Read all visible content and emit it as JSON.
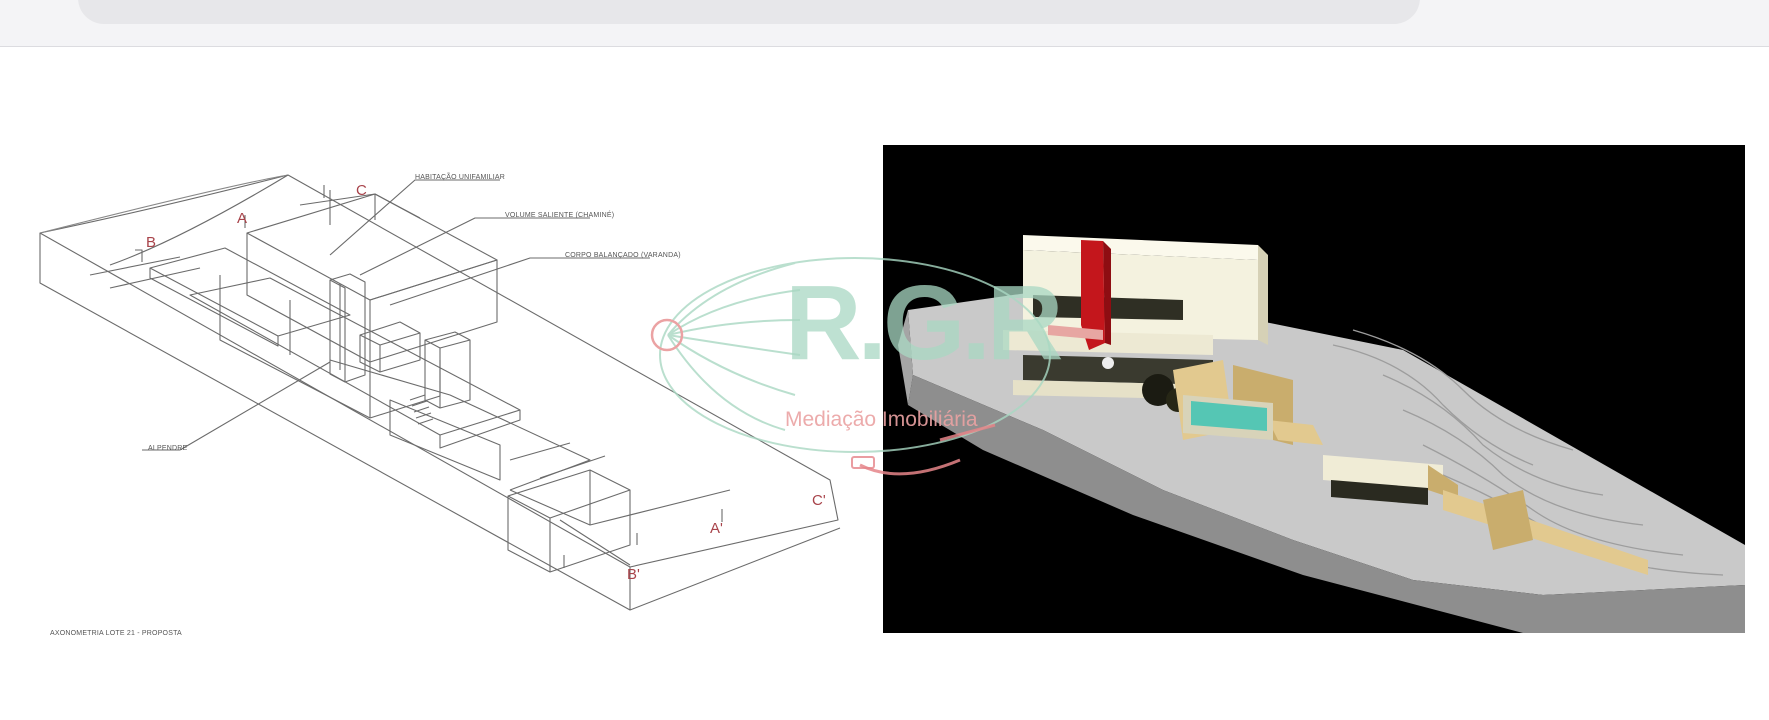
{
  "drawing": {
    "labels": {
      "l1": "HABITAÇÃO UNIFAMILIAR",
      "l2": "VOLUME SALIENTE (CHAMINÉ)",
      "l3": "CORPO BALANÇADO (VARANDA)",
      "l4": "ALPENDRE",
      "caption": "AXONOMETRIA LOTE 21 - PROPOSTA"
    },
    "letters": {
      "a": "A",
      "b": "B",
      "c": "C",
      "a2": "A'",
      "b2": "B'",
      "c2": "C'"
    }
  },
  "watermark": {
    "title": "R.G.R",
    "subtitle": "Mediação Imobiliária"
  },
  "colors": {
    "render_bg": "#000000",
    "accent_red": "#c4161c",
    "pool": "#55c6b4",
    "wall": "#e2c98f"
  }
}
